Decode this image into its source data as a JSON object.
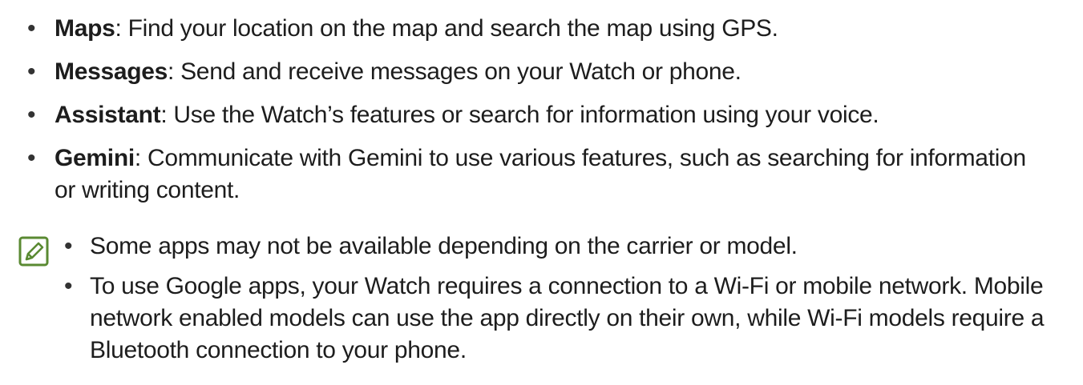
{
  "bullets": [
    {
      "term": "Maps",
      "description": ": Find your location on the map and search the map using GPS."
    },
    {
      "term": "Messages",
      "description": ": Send and receive messages on your Watch or phone."
    },
    {
      "term": "Assistant",
      "description": ": Use the Watch’s features or search for information using your voice."
    },
    {
      "term": "Gemini",
      "description": ": Communicate with Gemini to use various features, such as searching for information or writing content."
    }
  ],
  "note": {
    "icon": "note-pencil-icon",
    "icon_color": "#5a8a32",
    "items": [
      "Some apps may not be available depending on the carrier or model.",
      "To use Google apps, your Watch requires a connection to a Wi-Fi or mobile network. Mobile network enabled models can use the app directly on their own, while Wi-Fi models require a Bluetooth connection to your phone."
    ]
  }
}
